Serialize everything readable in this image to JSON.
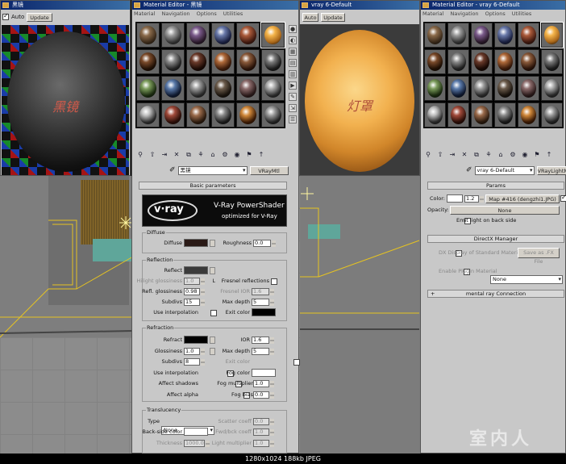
{
  "left_window": {
    "title": "黑镜",
    "auto_label": "Auto",
    "update_label": "Update",
    "preview_text": "黑镜"
  },
  "mid_editor": {
    "title": "Material Editor - 黑镜",
    "menus": [
      "Material",
      "Navigation",
      "Options",
      "Utilities"
    ],
    "material_name": "黑镜",
    "material_type": "VRayMtl",
    "rollout_title": "Basic parameters",
    "logo": {
      "brand": "v·ray",
      "line1": "V-Ray PowerShader",
      "line2": "optimized for V-Ray"
    },
    "diffuse": {
      "group": "Diffuse",
      "label": "Diffuse",
      "roughness_label": "Roughness",
      "roughness": "0.0"
    },
    "reflection": {
      "group": "Reflection",
      "reflect_label": "Reflect",
      "hilight_label": "Hilight glossiness",
      "hilight": "1.0",
      "l_label": "L",
      "fresnel_label": "Fresnel reflections",
      "refl_gloss_label": "Refl. glossiness",
      "refl_gloss": "0.98",
      "fresnel_ior_label": "Fresnel IOR",
      "fresnel_ior": "1.6",
      "subdivs_label": "Subdivs",
      "subdivs": "15",
      "max_depth_label": "Max depth",
      "max_depth": "5",
      "interp_label": "Use interpolation",
      "exit_label": "Exit color"
    },
    "refraction": {
      "group": "Refraction",
      "refract_label": "Refract",
      "ior_label": "IOR",
      "ior": "1.6",
      "gloss_label": "Glossiness",
      "gloss": "1.0",
      "max_depth_label": "Max depth",
      "max_depth": "5",
      "subdivs_label": "Subdivs",
      "subdivs": "8",
      "exit_label": "Exit color",
      "interp_label": "Use interpolation",
      "fog_color_label": "Fog color",
      "shadows_label": "Affect shadows",
      "fog_mult_label": "Fog multiplier",
      "fog_mult": "1.0",
      "alpha_label": "Affect alpha",
      "fog_bias_label": "Fog bias",
      "fog_bias": "0.0"
    },
    "translucency": {
      "group": "Translucency",
      "type_label": "Type",
      "type_value": "None",
      "scatter_label": "Scatter coeff",
      "scatter": "0.0",
      "backside_label": "Back-side color",
      "fwd_label": "Fwd/bck coeff",
      "fwd": "1.0",
      "thickness_label": "Thickness",
      "thickness": "1000.0",
      "light_mult_label": "Light multiplier",
      "light_mult": "1.0"
    }
  },
  "center_window": {
    "title": "vray 6-Default",
    "auto_label": "Auto",
    "update_label": "Update",
    "preview_text": "灯罩"
  },
  "right_editor": {
    "title": "Material Editor - vray 6-Default",
    "menus": [
      "Material",
      "Navigation",
      "Options",
      "Utilities"
    ],
    "material_name": "vray 6-Default",
    "material_type": "VRayLightMtl",
    "params": {
      "title": "Params",
      "color_label": "Color:",
      "color_value": "1.2",
      "map_label": "Map #416 (dengzhi1.JPG)",
      "opacity_label": "Opacity:",
      "opacity_value": "None",
      "emit_label": "Emit light on back side"
    },
    "directx": {
      "title": "DirectX Manager",
      "dx_label": "DX Display of Standard Material",
      "save_label": "Save as .FX File",
      "plugin_label": "Enable Plugin Material",
      "plugin_value": "None"
    },
    "mental_ray": {
      "title": "mental ray Connection"
    }
  },
  "status_bar": {
    "text": "1280x1024  188kb  JPEG"
  },
  "watermark": {
    "text": "室内人"
  }
}
